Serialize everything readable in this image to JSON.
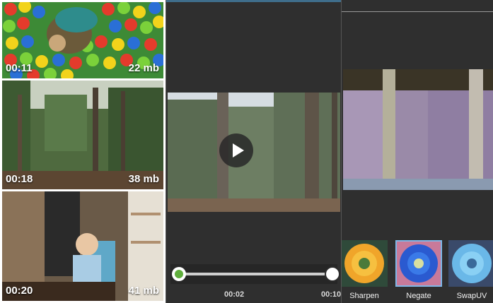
{
  "gallery": {
    "items": [
      {
        "duration": "00:11",
        "size": "22 mb"
      },
      {
        "duration": "00:18",
        "size": "38 mb"
      },
      {
        "duration": "00:20",
        "size": "41 mb"
      }
    ]
  },
  "player": {
    "current_time": "00:02",
    "total_time": "00:10",
    "accent_color": "#5fae3c"
  },
  "effects": {
    "filters": [
      {
        "label": "Sharpen"
      },
      {
        "label": "Negate",
        "selected": true
      },
      {
        "label": "SwapUV"
      }
    ],
    "selected_color": "#7fb7e8"
  }
}
